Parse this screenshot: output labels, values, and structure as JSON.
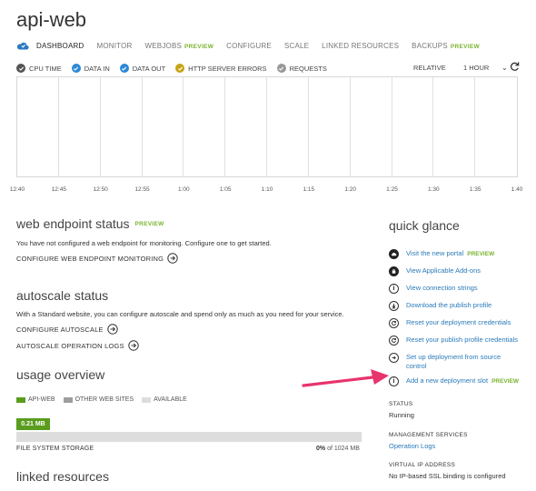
{
  "title": "api-web",
  "nav": {
    "tabs": [
      {
        "label": "DASHBOARD",
        "preview": ""
      },
      {
        "label": "MONITOR",
        "preview": ""
      },
      {
        "label": "WEBJOBS",
        "preview": "PREVIEW"
      },
      {
        "label": "CONFIGURE",
        "preview": ""
      },
      {
        "label": "SCALE",
        "preview": ""
      },
      {
        "label": "LINKED RESOURCES",
        "preview": ""
      },
      {
        "label": "BACKUPS",
        "preview": "PREVIEW"
      }
    ]
  },
  "metrics": [
    {
      "label": "CPU TIME",
      "color": "#555555"
    },
    {
      "label": "DATA IN",
      "color": "#2b88d8"
    },
    {
      "label": "DATA OUT",
      "color": "#2b88d8"
    },
    {
      "label": "HTTP SERVER ERRORS",
      "color": "#c8a415"
    },
    {
      "label": "REQUESTS",
      "color": "#999999"
    }
  ],
  "chart_controls": {
    "mode": "RELATIVE",
    "range": "1 HOUR"
  },
  "chart_data": {
    "type": "line",
    "x_ticks": [
      "12:40",
      "12:45",
      "12:50",
      "12:55",
      "1:00",
      "1:05",
      "1:10",
      "1:15",
      "1:20",
      "1:25",
      "1:30",
      "1:35",
      "1:40"
    ],
    "series": [],
    "grid": true
  },
  "web_endpoint": {
    "heading": "web endpoint status",
    "preview": "PREVIEW",
    "description": "You have not configured a web endpoint for monitoring. Configure one to get started.",
    "action": "CONFIGURE WEB ENDPOINT MONITORING"
  },
  "autoscale": {
    "heading": "autoscale status",
    "description": "With a Standard website, you can configure autoscale and spend only as much as you need for your service.",
    "actions": [
      "CONFIGURE AUTOSCALE",
      "AUTOSCALE OPERATION LOGS"
    ]
  },
  "usage": {
    "heading": "usage overview",
    "legend": [
      {
        "label": "API-WEB",
        "color": "#5a9d1e"
      },
      {
        "label": "OTHER WEB SITES",
        "color": "#9e9e9e"
      },
      {
        "label": "AVAILABLE",
        "color": "#dddddd"
      }
    ],
    "badge": "0.21 MB",
    "storage_label": "FILE SYSTEM STORAGE",
    "percent": "0%",
    "of_text": "of 1024 MB",
    "fill_fraction": 0.0002
  },
  "linked_resources": {
    "heading": "linked resources"
  },
  "quick_glance": {
    "heading": "quick glance",
    "links": [
      {
        "label": "Visit the new portal",
        "preview": "PREVIEW",
        "icon": "cloud-icon"
      },
      {
        "label": "View Applicable Add-ons",
        "preview": "",
        "icon": "bag-icon"
      },
      {
        "label": "View connection strings",
        "preview": "",
        "icon": "info-icon"
      },
      {
        "label": "Download the publish profile",
        "preview": "",
        "icon": "download-icon"
      },
      {
        "label": "Reset your deployment credentials",
        "preview": "",
        "icon": "reset-icon"
      },
      {
        "label": "Reset your publish profile credentials",
        "preview": "",
        "icon": "reset-icon"
      },
      {
        "label": "Set up deployment from source control",
        "preview": "",
        "icon": "arrow-right-icon"
      },
      {
        "label": "Add a new deployment slot",
        "preview": "PREVIEW",
        "icon": "info-icon"
      }
    ],
    "status": {
      "label": "STATUS",
      "value": "Running"
    },
    "management": {
      "label": "MANAGEMENT SERVICES",
      "value": "Operation Logs"
    },
    "vip": {
      "label": "VIRTUAL IP ADDRESS",
      "value": "No IP-based SSL binding is configured"
    }
  },
  "annotation_color": "#e8336d"
}
